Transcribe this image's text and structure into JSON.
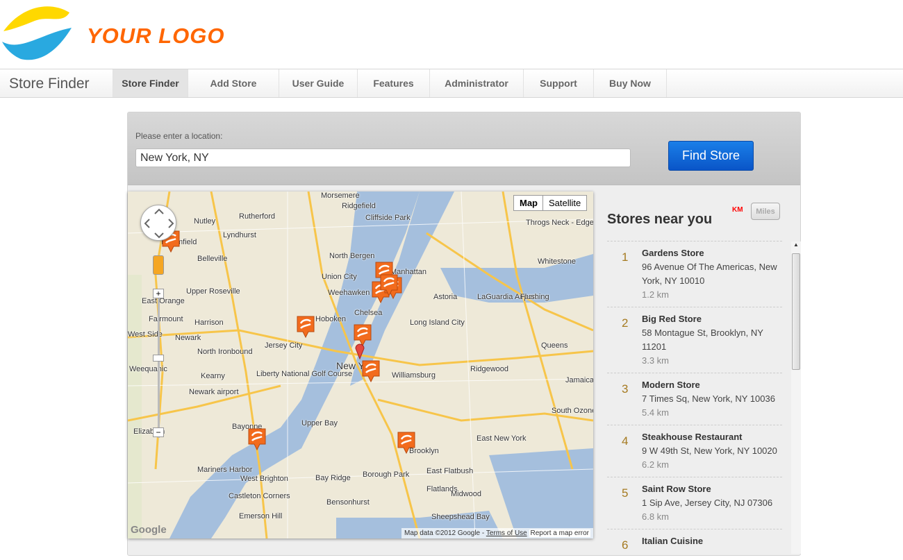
{
  "logo": {
    "text": "YOUR LOGO"
  },
  "nav": {
    "brand": "Store Finder",
    "tabs": [
      "Store Finder",
      "Add Store",
      "User Guide",
      "Features",
      "Administrator",
      "Support",
      "Buy Now"
    ]
  },
  "search": {
    "label": "Please enter a location:",
    "value": "New York, NY",
    "button": "Find Store"
  },
  "map": {
    "type_buttons": [
      "Map",
      "Satellite"
    ],
    "attribution": "Map data ©2012 Google",
    "terms": "Terms of Use",
    "report": "Report a map error",
    "google": "Google",
    "labels": [
      "Morsemere",
      "Ridgefield",
      "Rutherford",
      "Nutley",
      "Lyndhurst",
      "Cliffside Park",
      "Belleville",
      "North Bergen",
      "Union City",
      "Manhattan",
      "Weehawken",
      "Hoboken",
      "Chelsea",
      "Jersey City",
      "Newark",
      "Harrison",
      "East Orange",
      "Kearny",
      "New York",
      "Williamsburg",
      "Long Island City",
      "Astoria",
      "LaGuardia Airport",
      "Flushing",
      "Throgs Neck - Edgewater Park",
      "Whitestone",
      "Ridgewood",
      "Queens",
      "Jamaica",
      "Liberty National Golf Course",
      "Newark airport",
      "Upper Bay",
      "Bayonne",
      "Elizabeth",
      "Brooklyn",
      "East New York",
      "South Ozone Park",
      "Borough Park",
      "East Flatbush",
      "Flatlands",
      "Bay Ridge",
      "Midwood",
      "Bensonhurst",
      "Sheepshead Bay",
      "West Brighton",
      "Mariners Harbor",
      "Castleton Corners",
      "Emerson Hill",
      "Bloomfield",
      "Upper Roseville",
      "North Ironbound",
      "Weequahic",
      "Fairmount",
      "West Side"
    ],
    "pin_count": 10,
    "accent": "#f26b1d"
  },
  "sidebar": {
    "title": "Stores near you",
    "unit_km": "KM",
    "unit_miles": "Miles",
    "stores": [
      {
        "num": "1",
        "name": "Gardens Store",
        "address": "96 Avenue Of The Americas, New York, NY 10010",
        "distance": "1.2 km"
      },
      {
        "num": "2",
        "name": "Big Red Store",
        "address": "58 Montague St, Brooklyn, NY 11201",
        "distance": "3.3 km"
      },
      {
        "num": "3",
        "name": "Modern Store",
        "address": "7 Times Sq, New York, NY 10036",
        "distance": "5.4 km"
      },
      {
        "num": "4",
        "name": "Steakhouse Restaurant",
        "address": "9 W 49th St, New York, NY 10020",
        "distance": "6.2 km"
      },
      {
        "num": "5",
        "name": "Saint Row Store",
        "address": "1 Sip Ave, Jersey City, NJ 07306",
        "distance": "6.8 km"
      },
      {
        "num": "6",
        "name": "Italian Cuisine",
        "address": "",
        "distance": ""
      }
    ]
  }
}
